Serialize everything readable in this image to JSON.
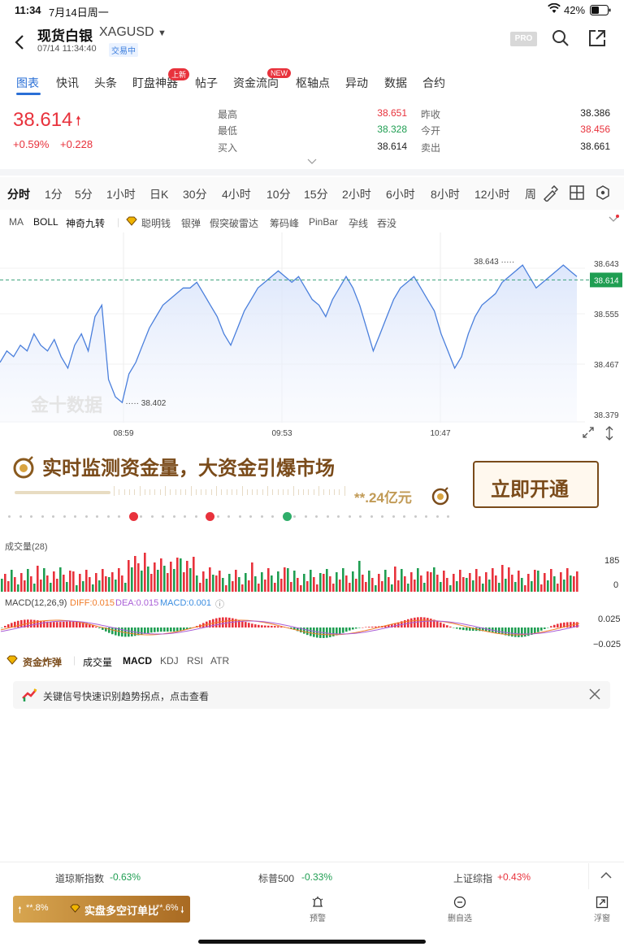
{
  "status": {
    "time": "11:34",
    "date": "7月14日周一",
    "battery": "42%"
  },
  "header": {
    "title": "现货白银",
    "symbol": "XAGUSD",
    "datetime": "07/14 11:34:40",
    "trade_status": "交易中",
    "pro_label": "PRO"
  },
  "tabs": [
    {
      "label": "图表"
    },
    {
      "label": "快讯"
    },
    {
      "label": "头条"
    },
    {
      "label": "盯盘神器",
      "badge": "上新"
    },
    {
      "label": "帖子"
    },
    {
      "label": "资金流向",
      "badge": "NEW"
    },
    {
      "label": "枢轴点"
    },
    {
      "label": "异动"
    },
    {
      "label": "数据"
    },
    {
      "label": "合约"
    }
  ],
  "quote": {
    "price": "38.614",
    "change_pct": "+0.59%",
    "change": "+0.228",
    "high_label": "最高",
    "high": "38.651",
    "low_label": "最低",
    "low": "38.328",
    "bid_label": "买入",
    "bid": "38.614",
    "prev_close_label": "昨收",
    "prev_close": "38.386",
    "open_label": "今开",
    "open": "38.456",
    "ask_label": "卖出",
    "ask": "38.661"
  },
  "periods": [
    "分时",
    "1分",
    "5分",
    "1小时",
    "日K",
    "30分",
    "4小时",
    "10分",
    "15分",
    "2小时",
    "6小时",
    "8小时",
    "12小时",
    "周"
  ],
  "indicators": {
    "left": [
      "MA",
      "BOLL",
      "神奇九转"
    ],
    "right": [
      "聪明钱",
      "银弹",
      "假突破雷达",
      "筹码峰",
      "PinBar",
      "孕线",
      "吞没"
    ]
  },
  "chart_data": {
    "type": "line",
    "y_ticks": [
      "38.643",
      "38.614",
      "38.555",
      "38.467",
      "38.379"
    ],
    "ylim": [
      38.379,
      38.643
    ],
    "x_ticks": [
      "08:59",
      "09:53",
      "10:47"
    ],
    "max_label": "38.643",
    "min_label": "38.402",
    "current": "38.614",
    "watermark": "金十数据",
    "series": [
      {
        "values": [
          38.47,
          38.49,
          38.48,
          38.5,
          38.49,
          38.52,
          38.5,
          38.49,
          38.51,
          38.48,
          38.46,
          38.5,
          38.52,
          38.49,
          38.55,
          38.57,
          38.44,
          38.41,
          38.4,
          38.45,
          38.47,
          38.5,
          38.53,
          38.55,
          38.57,
          38.58,
          38.59,
          38.6,
          38.6,
          38.61,
          38.59,
          38.57,
          38.55,
          38.52,
          38.5,
          38.53,
          38.56,
          38.58,
          38.6,
          38.61,
          38.62,
          38.63,
          38.62,
          38.61,
          38.62,
          38.6,
          38.58,
          38.57,
          38.55,
          38.58,
          38.6,
          38.62,
          38.6,
          38.57,
          38.53,
          38.49,
          38.52,
          38.55,
          38.58,
          38.6,
          38.61,
          38.62,
          38.6,
          38.58,
          38.56,
          38.52,
          38.49,
          38.46,
          38.48,
          38.52,
          38.55,
          38.57,
          38.58,
          38.59,
          38.61,
          38.62,
          38.63,
          38.64,
          38.62,
          38.6,
          38.61,
          38.62,
          38.63,
          38.64,
          38.63,
          38.62
        ]
      }
    ]
  },
  "banner": {
    "headline": "实时监测资金量，大资金引爆市场",
    "amount": "**.24亿元",
    "button": "立即开通"
  },
  "volume": {
    "label": "成交量(28)",
    "max": "185",
    "zero": "0"
  },
  "macd": {
    "label": "MACD(12,26,9)",
    "diff": "DIFF:0.015",
    "dea": "DEA:0.015",
    "macd": "MACD:0.001",
    "top": "0.025",
    "bottom": "−0.025"
  },
  "subtabs": [
    "资金炸弹",
    "成交量",
    "MACD",
    "KDJ",
    "RSI",
    "ATR"
  ],
  "notice": "关键信号快速识别趋势拐点，点击查看",
  "indices": [
    {
      "name": "道琼斯指数",
      "value": "-0.63%",
      "color": "#1f9e52"
    },
    {
      "name": "标普500",
      "value": "-0.33%",
      "color": "#1f9e52"
    },
    {
      "name": "上证综指",
      "value": "+0.43%",
      "color": "#e8323c"
    }
  ],
  "bottom": {
    "long_pct": "**.8%",
    "short_pct": "**.6%",
    "ratio_label": "实盘多空订单比",
    "alert": "预警",
    "remove": "删自选",
    "float": "浮窗"
  }
}
